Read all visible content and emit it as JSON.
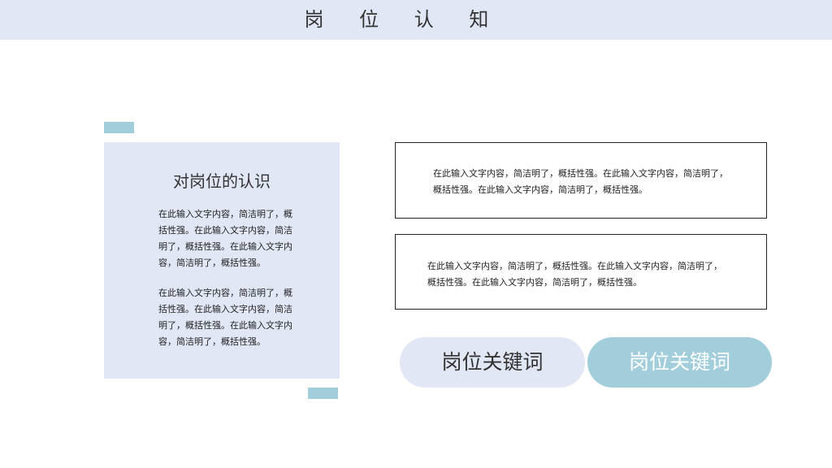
{
  "header": {
    "title": "岗 位 认 知"
  },
  "recognition_card": {
    "title": "对岗位的认识",
    "paragraph_1": "在此输入文字内容，简洁明了，概括性强。在此输入文字内容，简洁明了，概括性强。在此输入文字内容，简洁明了，概括性强。",
    "paragraph_2": "在此输入文字内容，简洁明了，概括性强。在此输入文字内容，简洁明了，概括性强。在此输入文字内容，简洁明了，概括性强。"
  },
  "text_boxes": [
    {
      "text": "在此输入文字内容，简洁明了，概括性强。在此输入文字内容，简洁明了，概括性强。在此输入文字内容，简洁明了，概括性强。"
    },
    {
      "text": "在此输入文字内容，简洁明了，概括性强。在此输入文字内容，简洁明了，概括性强。在此输入文字内容，简洁明了，概括性强。"
    }
  ],
  "keywords": [
    {
      "label": "岗位关键词"
    },
    {
      "label": "岗位关键词"
    }
  ],
  "colors": {
    "banner": "#e1e7f5",
    "accent": "#a2cedb",
    "text": "#222222"
  }
}
